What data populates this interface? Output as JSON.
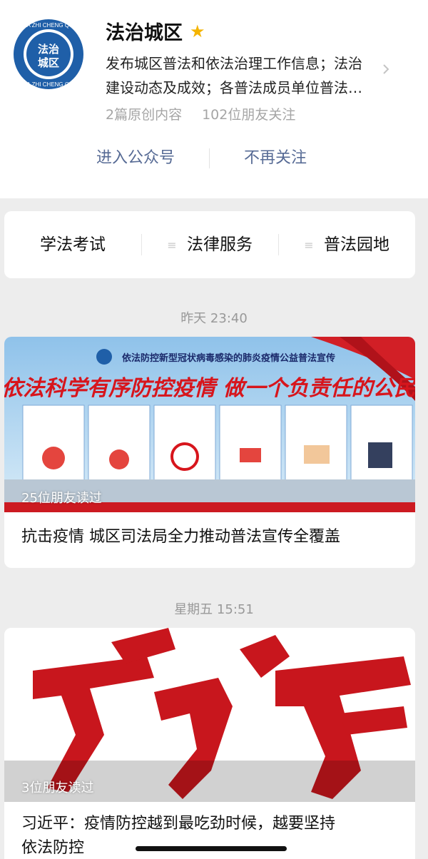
{
  "account": {
    "name": "法治城区",
    "logo_text": "法治城区",
    "logo_ring_text": "FA ZHI CHENG QU",
    "description_line1": "发布城区普法和依法治理工作信息；法治",
    "description_line2": "建设动态及成效；各普法成员单位普法…",
    "original_count": "2篇原创内容",
    "friends_following": "102位朋友关注",
    "enter_label": "进入公众号",
    "unfollow_label": "不再关注"
  },
  "menu": {
    "items": [
      {
        "label": "学法考试"
      },
      {
        "label": "法律服务"
      },
      {
        "label": "普法园地"
      }
    ]
  },
  "articles": [
    {
      "time": "昨天 23:40",
      "banner_top": "依法防控新型冠状病毒感染的肺炎疫情公益普法宣传",
      "banner_headline": "依法科学有序防控疫情 做一个负责任的公民",
      "read_count": "25位朋友读过",
      "title": "抗击疫情  城区司法局全力推动普法宣传全覆盖"
    },
    {
      "time": "星期五 15:51",
      "read_count": "3位朋友读过",
      "title_line1": "习近平：疫情防控越到最吃劲时候，越要坚持",
      "title_line2": "依法防控"
    }
  ],
  "watermark": "法治城区",
  "colors": {
    "link": "#576b95",
    "star": "#f4b400",
    "logo_blue": "#1f5fa8",
    "brush_red": "#c8161d"
  }
}
